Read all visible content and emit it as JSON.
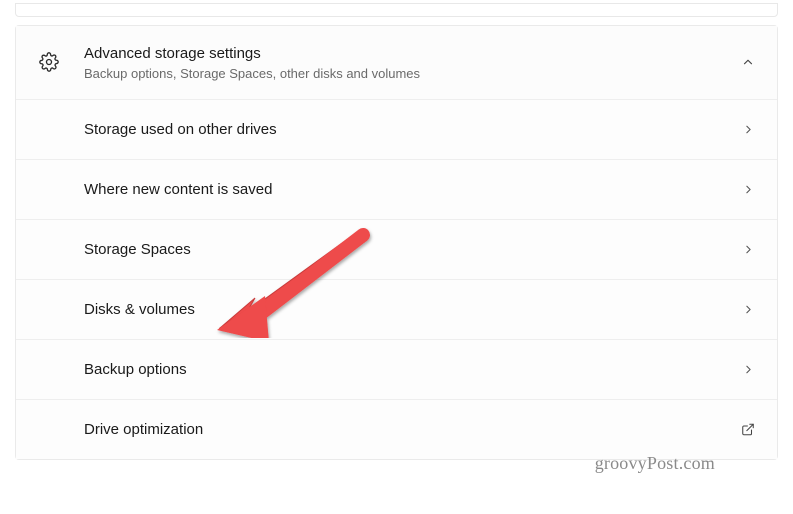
{
  "header": {
    "title": "Advanced storage settings",
    "subtitle": "Backup options, Storage Spaces, other disks and volumes"
  },
  "items": [
    {
      "label": "Storage used on other drives",
      "action": "chevron"
    },
    {
      "label": "Where new content is saved",
      "action": "chevron"
    },
    {
      "label": "Storage Spaces",
      "action": "chevron"
    },
    {
      "label": "Disks & volumes",
      "action": "chevron"
    },
    {
      "label": "Backup options",
      "action": "chevron"
    },
    {
      "label": "Drive optimization",
      "action": "external"
    }
  ],
  "watermark": "groovyPost.com"
}
